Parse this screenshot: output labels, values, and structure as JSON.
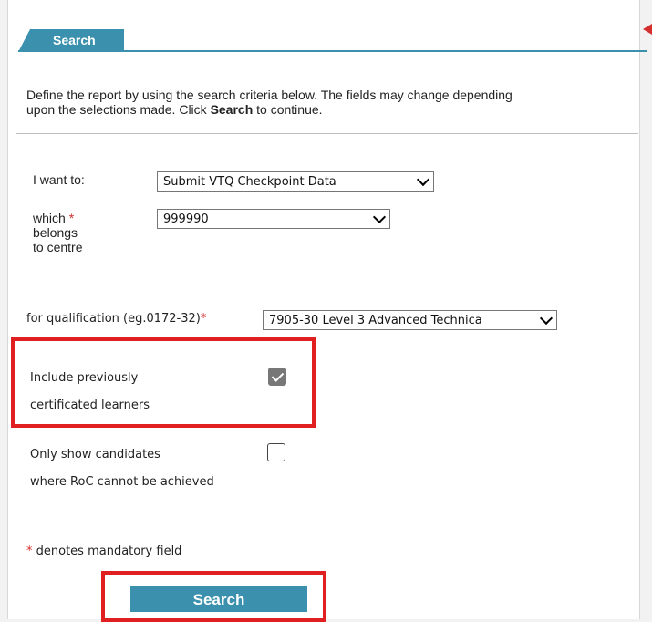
{
  "tab": {
    "label": "Search"
  },
  "intro": {
    "line1": "Define the report by using the search criteria below. The fields may change depending",
    "line2_prefix": "upon the selections made. Click ",
    "line2_bold": "Search",
    "line2_suffix": " to continue."
  },
  "fields": {
    "i_want_to": {
      "label": "I want to:",
      "value": "Submit VTQ Checkpoint Data"
    },
    "centre": {
      "label_line1": "which",
      "required_mark": "*",
      "label_line2": "belongs",
      "label_line3": "to centre",
      "value": "999990"
    },
    "qualification": {
      "label": "for qualification (eg.0172-32)",
      "required_mark": "*",
      "value": "7905-30 Level 3 Advanced Technica"
    }
  },
  "checkboxes": {
    "include_previous": {
      "label_line1": "Include previously",
      "label_line2": "certificated learners",
      "checked": true
    },
    "roc": {
      "label_line1": "Only show candidates",
      "label_line2": "where RoC cannot be achieved",
      "checked": false
    }
  },
  "mandatory_note": {
    "mark": "*",
    "text": " denotes mandatory field"
  },
  "search_button": {
    "label": "Search"
  },
  "colors": {
    "accent": "#3a90ad",
    "highlight": "#e02020",
    "required": "#d32f2f"
  }
}
